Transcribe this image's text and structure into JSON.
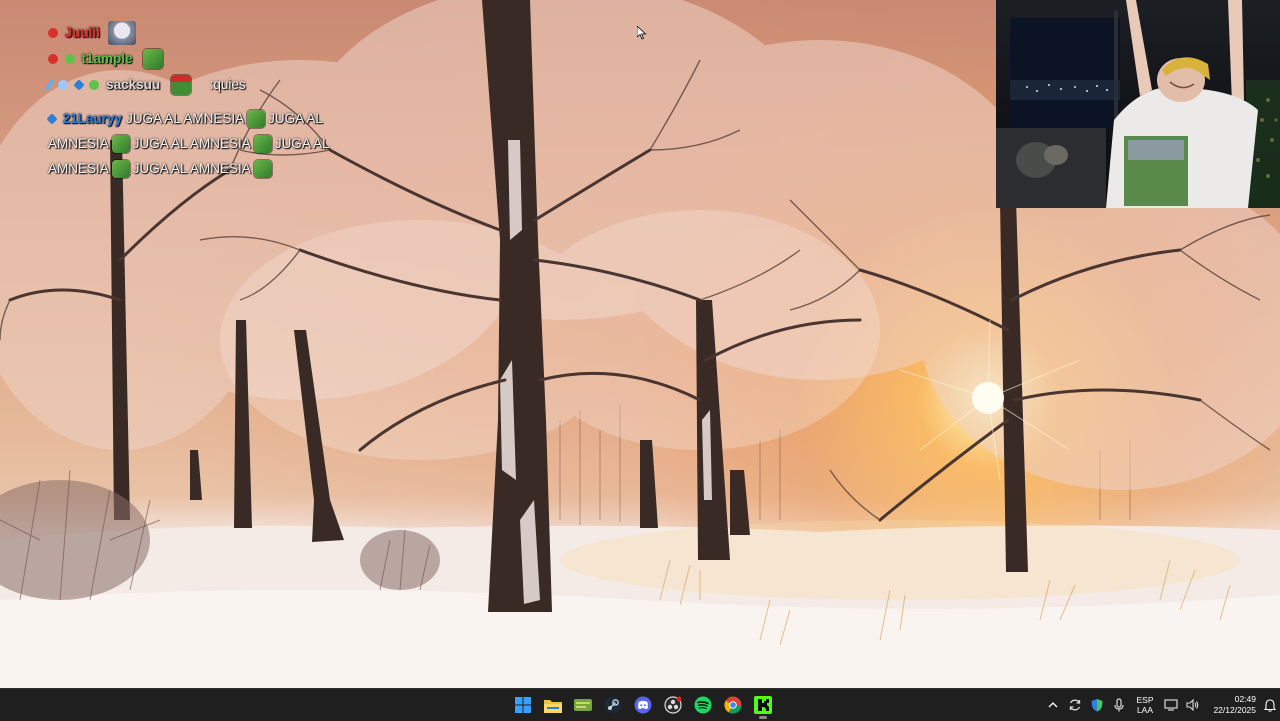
{
  "chat": {
    "messages": [
      {
        "username": "Juulii",
        "username_color": "#e0322a"
      },
      {
        "username": "t1ample",
        "username_color": "#58c04a"
      },
      {
        "username": "sacksuu",
        "username_color": "#dcdcdc",
        "text": ":quies"
      }
    ],
    "spam": {
      "username": "21Lauryy",
      "username_color": "#2d7fe0",
      "lines": [
        "JUGA AL AMNESIA",
        "JUGA AL",
        "AMNESIA",
        "JUGA AL AMNESIA",
        "JUGA AL",
        "AMNESIA",
        "JUGA AL AMNESIA"
      ]
    }
  },
  "taskbar": {
    "apps": [
      {
        "name": "start-button",
        "icon": "windows-logo-icon"
      },
      {
        "name": "file-explorer",
        "icon": "folder-icon"
      },
      {
        "name": "app-green-hat",
        "icon": "green-cap-icon"
      },
      {
        "name": "steam",
        "icon": "steam-icon"
      },
      {
        "name": "discord",
        "icon": "discord-icon"
      },
      {
        "name": "obs",
        "icon": "obs-icon"
      },
      {
        "name": "spotify",
        "icon": "spotify-icon"
      },
      {
        "name": "chrome",
        "icon": "chrome-icon"
      },
      {
        "name": "kick",
        "icon": "kick-icon"
      }
    ],
    "language": {
      "line1": "ESP",
      "line2": "LAA"
    },
    "clock": {
      "time": "02:49",
      "date": "22/12/2025"
    },
    "colors": {
      "background": "#1f1f1f",
      "accent": "#53fc18"
    }
  }
}
